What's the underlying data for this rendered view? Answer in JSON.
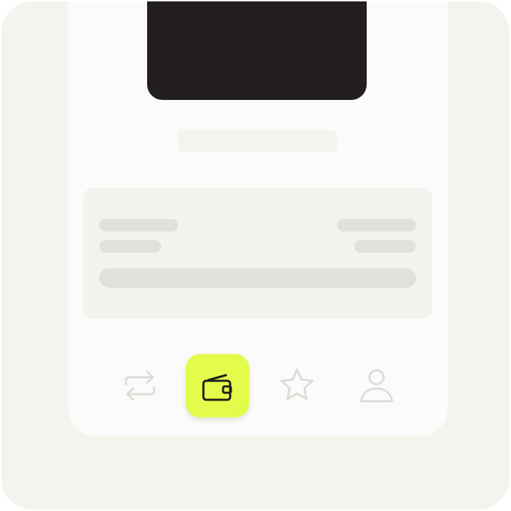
{
  "colors": {
    "background": "#f4f4ee",
    "phone": "#fbfbfb",
    "notch": "#231f1e",
    "placeholder": "#e1e0da",
    "accent": "#e3fb4b",
    "icon_inactive": "#dcdbd4",
    "icon_active": "#1d1d1b"
  },
  "nav": {
    "items": [
      {
        "id": "transfer",
        "icon": "arrows-swap-icon",
        "active": false
      },
      {
        "id": "wallet",
        "icon": "wallet-icon",
        "active": true
      },
      {
        "id": "favorites",
        "icon": "star-icon",
        "active": false
      },
      {
        "id": "profile",
        "icon": "user-icon",
        "active": false
      }
    ]
  }
}
